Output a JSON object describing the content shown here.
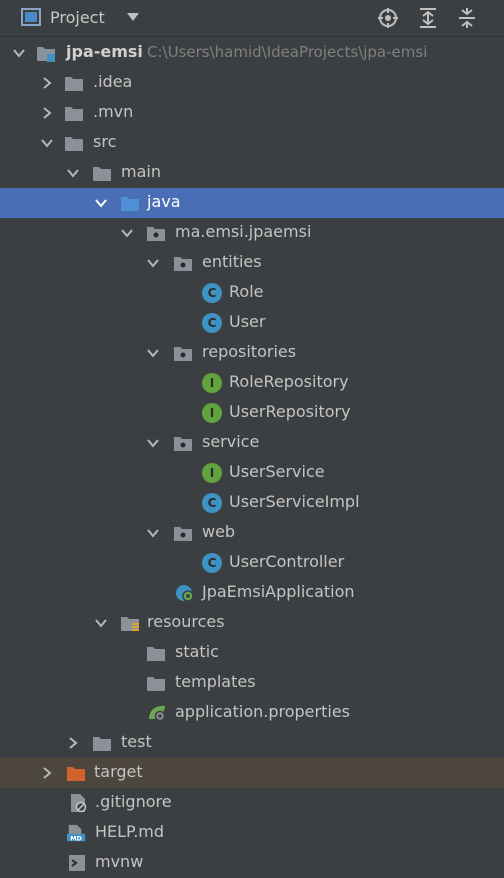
{
  "toolbar": {
    "title": "Project",
    "colors": {
      "bg": "#3c3f41"
    }
  },
  "tree": {
    "root": {
      "label": "jpa-emsi",
      "path": "C:\\Users\\hamid\\IdeaProjects\\jpa-emsi"
    },
    "idea": ".idea",
    "mvn": ".mvn",
    "src": "src",
    "main": "main",
    "java": "java",
    "package": "ma.emsi.jpaemsi",
    "entities": "entities",
    "role": "Role",
    "user": "User",
    "repositories": "repositories",
    "role_repository": "RoleRepository",
    "user_repository": "UserRepository",
    "service": "service",
    "user_service": "UserService",
    "user_service_impl": "UserServiceImpl",
    "web": "web",
    "user_controller": "UserController",
    "app": "JpaEmsiApplication",
    "resources": "resources",
    "static": "static",
    "templates": "templates",
    "app_props": "application.properties",
    "test": "test",
    "target": "target",
    "gitignore": ".gitignore",
    "help": "HELP.md",
    "mvnw": "mvnw"
  },
  "icons": {
    "class_badge": "C",
    "interface_badge": "I",
    "md_badge": "MD"
  },
  "colors": {
    "selection": "#4a6eb5",
    "excluded": "#4c463c",
    "class_icon": "#3d94c4",
    "interface_icon": "#62a33d",
    "folder": "#8a9198",
    "java_folder": "#4f8fd6",
    "target_folder": "#d1622b"
  }
}
